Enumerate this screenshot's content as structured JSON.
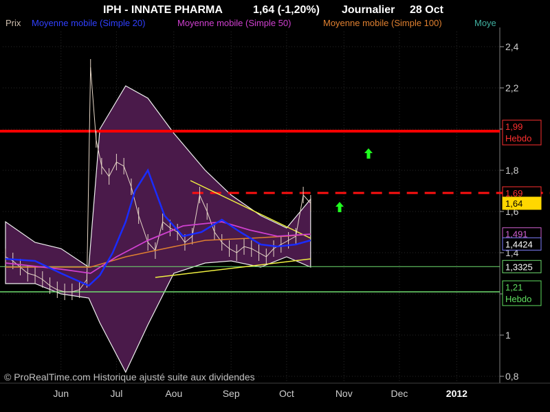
{
  "header": {
    "ticker": "IPH - INNATE PHARMA",
    "quote": "1,64 (-1,20%)",
    "period": "Journalier",
    "date": "28 Oct"
  },
  "legend": {
    "price": "Prix",
    "ma20": "Moyenne mobile (Simple 20)",
    "ma50": "Moyenne mobile (Simple 50)",
    "ma100": "Moyenne mobile (Simple 100)",
    "ma_cut": "Moye"
  },
  "colors": {
    "background": "#000000",
    "candles": "#e8d8c8",
    "bollinger_fill": "#4a1a4a",
    "bollinger_edge": "#f0f0f0",
    "ma20": "#1a2cff",
    "ma50": "#d040d0",
    "ma100": "#e08030",
    "cyan_ma": "#40b0c0",
    "resistance_weekly": "#ff0000",
    "resistance_dashed": "#ff1010",
    "triangle": "#f0f040",
    "support_green": "#70e070",
    "arrow": "#20ff20",
    "price_badge": "#ffd700"
  },
  "watermark": "© ProRealTime.com Historique ajusté suite aux dividendes",
  "chart_data": {
    "type": "line",
    "title": "IPH - INNATE PHARMA",
    "x_labels": [
      "Jun",
      "Jul",
      "Aou",
      "Sep",
      "Oct",
      "Nov",
      "Dec",
      "2012"
    ],
    "y_ticks": [
      "2,4",
      "2,2",
      "2",
      "1,8",
      "1,6",
      "1,4",
      "1,2",
      "1",
      "0,8"
    ],
    "ylim": [
      0.8,
      2.5
    ],
    "price": {
      "name": "Prix",
      "x": [
        "2011-05-16",
        "2011-05-20",
        "2011-05-24",
        "2011-05-28",
        "2011-06-01",
        "2011-06-05",
        "2011-06-09",
        "2011-06-13",
        "2011-06-17",
        "2011-06-21",
        "2011-06-25",
        "2011-06-29",
        "2011-07-01",
        "2011-07-04",
        "2011-07-07",
        "2011-07-11",
        "2011-07-15",
        "2011-07-19",
        "2011-07-23",
        "2011-07-27",
        "2011-08-01",
        "2011-08-05",
        "2011-08-09",
        "2011-08-13",
        "2011-08-17",
        "2011-08-21",
        "2011-08-25",
        "2011-08-29",
        "2011-09-02",
        "2011-09-06",
        "2011-09-10",
        "2011-09-14",
        "2011-09-18",
        "2011-09-22",
        "2011-09-26",
        "2011-09-30",
        "2011-10-04",
        "2011-10-08",
        "2011-10-12",
        "2011-10-16",
        "2011-10-20",
        "2011-10-24",
        "2011-10-28"
      ],
      "y": [
        1.38,
        1.36,
        1.33,
        1.3,
        1.29,
        1.27,
        1.24,
        1.22,
        1.21,
        1.21,
        1.22,
        1.27,
        2.3,
        1.95,
        1.82,
        1.77,
        1.84,
        1.82,
        1.72,
        1.58,
        1.45,
        1.41,
        1.55,
        1.52,
        1.5,
        1.45,
        1.48,
        1.68,
        1.6,
        1.5,
        1.45,
        1.42,
        1.4,
        1.43,
        1.42,
        1.4,
        1.38,
        1.42,
        1.44,
        1.46,
        1.48,
        1.68,
        1.64
      ]
    },
    "ma20": {
      "name": "Moyenne mobile (Simple 20)",
      "x": [
        "2011-05-16",
        "2011-06-01",
        "2011-06-15",
        "2011-06-30",
        "2011-07-06",
        "2011-07-13",
        "2011-07-20",
        "2011-07-25",
        "2011-08-01",
        "2011-08-10",
        "2011-08-20",
        "2011-08-30",
        "2011-09-10",
        "2011-09-20",
        "2011-10-01",
        "2011-10-10",
        "2011-10-20",
        "2011-10-28"
      ],
      "y": [
        1.37,
        1.36,
        1.3,
        1.24,
        1.29,
        1.4,
        1.55,
        1.7,
        1.8,
        1.58,
        1.48,
        1.5,
        1.56,
        1.5,
        1.44,
        1.43,
        1.44,
        1.46
      ]
    },
    "ma50": {
      "name": "Moyenne mobile (Simple 50)",
      "x": [
        "2011-05-16",
        "2011-06-15",
        "2011-07-01",
        "2011-07-15",
        "2011-08-01",
        "2011-08-20",
        "2011-09-10",
        "2011-09-25",
        "2011-10-10",
        "2011-10-28"
      ],
      "y": [
        1.35,
        1.32,
        1.3,
        1.38,
        1.46,
        1.53,
        1.55,
        1.51,
        1.48,
        1.49
      ]
    },
    "ma100": {
      "name": "Moyenne mobile (Simple 100)",
      "x": [
        "2011-05-16",
        "2011-06-15",
        "2011-07-01",
        "2011-07-20",
        "2011-08-10",
        "2011-09-01",
        "2011-09-25",
        "2011-10-15",
        "2011-10-28"
      ],
      "y": [
        1.33,
        1.33,
        1.33,
        1.38,
        1.42,
        1.46,
        1.47,
        1.48,
        1.49
      ]
    },
    "bollinger": {
      "x": [
        "2011-05-16",
        "2011-06-01",
        "2011-06-15",
        "2011-06-30",
        "2011-07-06",
        "2011-07-20",
        "2011-08-01",
        "2011-08-15",
        "2011-09-01",
        "2011-09-15",
        "2011-10-01",
        "2011-10-15",
        "2011-10-28"
      ],
      "upper": [
        1.55,
        1.45,
        1.42,
        1.33,
        2.0,
        2.21,
        2.15,
        1.98,
        1.8,
        1.68,
        1.58,
        1.52,
        1.66
      ],
      "lower": [
        1.25,
        1.25,
        1.2,
        1.18,
        1.06,
        0.82,
        1.05,
        1.3,
        1.35,
        1.36,
        1.33,
        1.38,
        1.33
      ]
    },
    "levels": [
      {
        "label": "1,99",
        "sub": "Hebdo",
        "value": 1.99
      },
      {
        "label": "1,69",
        "value": 1.69
      },
      {
        "label": "1,64",
        "value": 1.64
      },
      {
        "label": "1,491",
        "value": 1.491
      },
      {
        "label": "1,4424",
        "value": 1.4424
      },
      {
        "label": "1,3325",
        "value": 1.3325
      },
      {
        "label": "1,21",
        "sub": "Hebdo",
        "value": 1.21
      }
    ]
  }
}
